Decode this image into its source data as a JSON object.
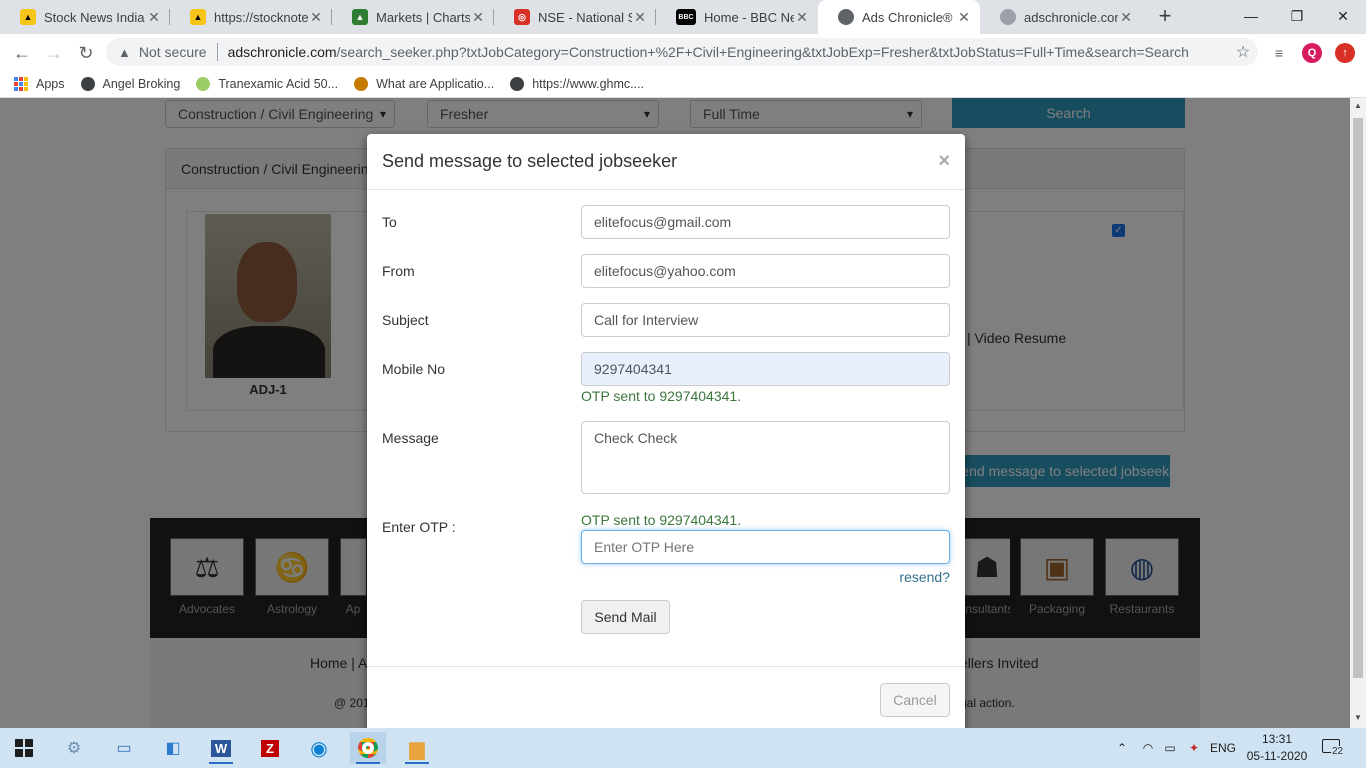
{
  "browser": {
    "tabs": [
      {
        "title": "Stock News India",
        "color": "#f5c518",
        "glyph": "▲",
        "active": false
      },
      {
        "title": "https://stocknote.",
        "color": "#f5c518",
        "glyph": "▲",
        "active": false
      },
      {
        "title": "Markets | Charts |",
        "color": "#2e7d32",
        "glyph": "▲",
        "active": false
      },
      {
        "title": "NSE - National Sto",
        "color": "#d93025",
        "glyph": "◎",
        "active": false
      },
      {
        "title": "Home - BBC News",
        "color": "#000000",
        "glyph": "BBC",
        "active": false
      },
      {
        "title": "Ads Chronicle®",
        "color": "#5f6368",
        "glyph": "◍",
        "active": true
      },
      {
        "title": "adschronicle.com/",
        "color": "#5f6368",
        "glyph": "◍",
        "active": false
      }
    ],
    "new_tab": "+",
    "window_controls": {
      "minimize": "—",
      "restore": "❐",
      "close": "✕"
    },
    "nav": {
      "back": "←",
      "forward": "→",
      "reload": "↻"
    },
    "security_label": "Not secure",
    "url_host": "adschronicle.com",
    "url_path": "/search_seeker.php?txtJobCategory=Construction+%2F+Civil+Engineering&txtJobExp=Fresher&txtJobStatus=Full+Time&search=Search",
    "profile_initial": "Q",
    "bookmarks": [
      {
        "label": "Apps",
        "icon": "apps-grid-icon"
      },
      {
        "label": "Angel Broking",
        "icon": "globe-icon",
        "color": "#3c4043"
      },
      {
        "label": "Tranexamic Acid 50...",
        "icon": "leaf-icon",
        "color": "#9ccc65"
      },
      {
        "label": "What are Applicatio...",
        "icon": "quiz-icon",
        "color": "#c57a00"
      },
      {
        "label": "https://www.ghmc....",
        "icon": "globe-icon",
        "color": "#3c4043"
      }
    ]
  },
  "page": {
    "filters": {
      "category": "Construction / Civil Engineering",
      "experience": "Fresher",
      "status": "Full Time",
      "search_button": "Search"
    },
    "results_heading": "Construction / Civil Engineering",
    "seeker": {
      "code": "ADJ-1",
      "video_resume": "| Video Resume"
    },
    "send_selected_button": "Send message to selected jobseeker",
    "categories": [
      {
        "label": "Advocates",
        "icon": "⚖"
      },
      {
        "label": "Astrology",
        "icon": "♋"
      },
      {
        "label": "Ap",
        "icon": "◼"
      },
      {
        "label": "Consultants",
        "icon": "☗"
      },
      {
        "label": "Packaging",
        "icon": "📦"
      },
      {
        "label": "Restaurants",
        "icon": "🍽"
      }
    ],
    "footer": {
      "links": "Home | A",
      "sellers": "ellers Invited",
      "copyright": "@ 201",
      "legal": "gal action."
    }
  },
  "modal": {
    "title": "Send message to selected jobseeker",
    "close": "×",
    "fields": {
      "to": {
        "label": "To",
        "value": "elitefocus@gmail.com"
      },
      "from": {
        "label": "From",
        "value": "elitefocus@yahoo.com"
      },
      "subject": {
        "label": "Subject",
        "value": "Call for Interview"
      },
      "mobile": {
        "label": "Mobile No",
        "value": "9297404341"
      },
      "message": {
        "label": "Message",
        "value": "Check Check"
      },
      "otp": {
        "label": "Enter OTP :",
        "placeholder": "Enter OTP Here"
      }
    },
    "otp_sent_mobile": "OTP sent to  9297404341.",
    "otp_sent_otp": "OTP sent to  9297404341.",
    "resend": "resend?",
    "send_button": "Send Mail",
    "cancel_button": "Cancel"
  },
  "taskbar": {
    "language": "ENG",
    "time": "13:31",
    "date": "05-11-2020",
    "notifications": "22"
  },
  "colors": {
    "accent": "#2f9bbf",
    "success_text": "#3c763d",
    "link_text": "#31708f",
    "taskbar": "#cfe3f2"
  }
}
